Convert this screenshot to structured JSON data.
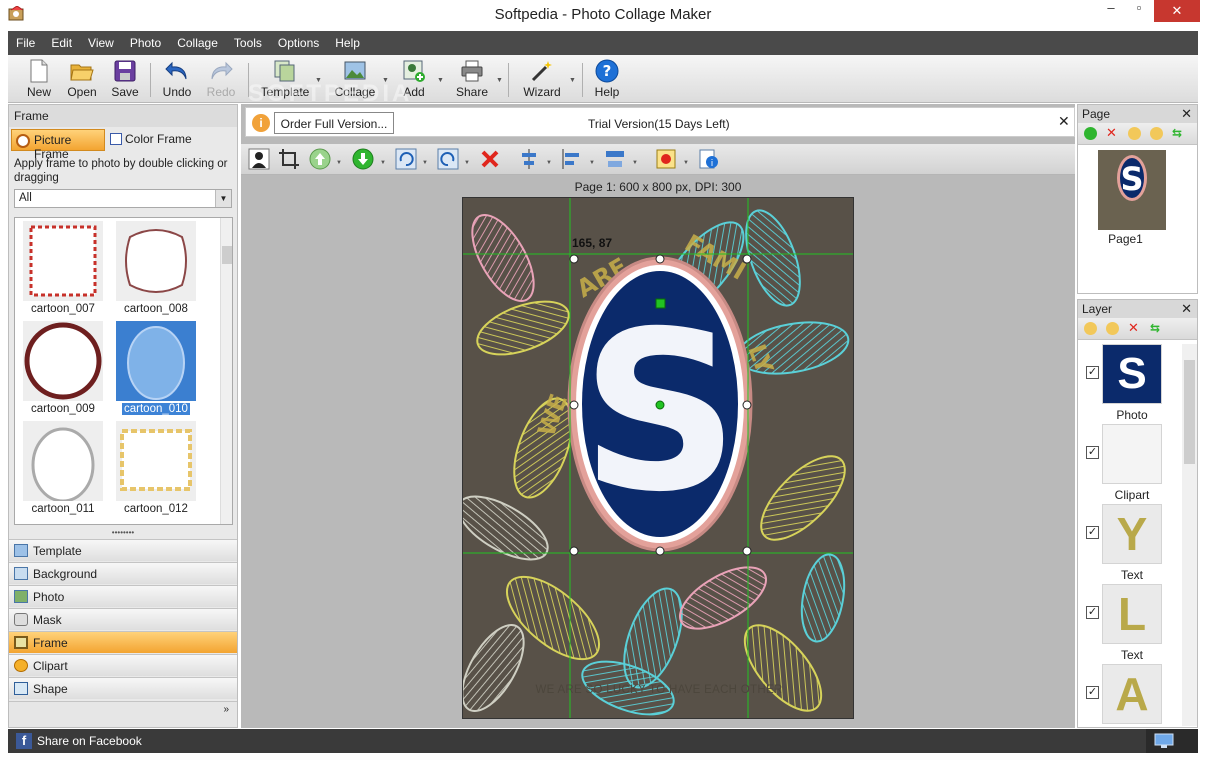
{
  "window": {
    "title": "Softpedia - Photo Collage Maker",
    "minimize": "–",
    "restore": "▫",
    "close": "✕"
  },
  "menu": [
    "File",
    "Edit",
    "View",
    "Photo",
    "Collage",
    "Tools",
    "Options",
    "Help"
  ],
  "toolbar": {
    "new": "New",
    "open": "Open",
    "save": "Save",
    "undo": "Undo",
    "redo": "Redo",
    "template": "Template",
    "collage": "Collage",
    "add": "Add",
    "share": "Share",
    "wizard": "Wizard",
    "help": "Help"
  },
  "watermark": "SOFTPEDIA",
  "left_panel": {
    "header": "Frame",
    "tab_picture": "Picture Frame",
    "tab_color": "Color Frame",
    "instruction": "Apply frame to photo by double clicking or dragging",
    "filter_value": "All",
    "frames": [
      "cartoon_007",
      "cartoon_008",
      "cartoon_009",
      "cartoon_010",
      "cartoon_011",
      "cartoon_012"
    ],
    "selected_frame": "cartoon_010",
    "nav": [
      "Template",
      "Background",
      "Photo",
      "Mask",
      "Frame",
      "Clipart",
      "Shape"
    ],
    "active_nav": "Frame",
    "more": "»"
  },
  "infobar": {
    "order_button": "Order Full Version...",
    "trial": "Trial Version(15 Days Left)",
    "icon": "i",
    "close": "✕"
  },
  "canvas": {
    "page_info": "Page 1: 600 x 800 px, DPI: 300",
    "coord": "165, 87",
    "caption": "WE ARE SO LUCKY TO HAVE EACH OTHER",
    "photo_letter": "S"
  },
  "page_panel": {
    "title": "Page",
    "page_label": "Page1",
    "close": "✕"
  },
  "layer_panel": {
    "title": "Layer",
    "close": "✕",
    "layers": [
      {
        "name": "Photo",
        "glyph": "S",
        "checked": "✓"
      },
      {
        "name": "Clipart",
        "glyph": "",
        "checked": "✓"
      },
      {
        "name": "Text",
        "glyph": "Y",
        "checked": "✓"
      },
      {
        "name": "Text",
        "glyph": "L",
        "checked": "✓"
      },
      {
        "name": "",
        "glyph": "A",
        "checked": "✓"
      }
    ]
  },
  "status": {
    "share_facebook": "Share on Facebook",
    "fb_icon": "f"
  },
  "colors": {
    "accent_orange": "#f3a431",
    "menubar": "#4a4a4a",
    "canvas_bg": "#585148",
    "guide_green": "#22c322"
  }
}
